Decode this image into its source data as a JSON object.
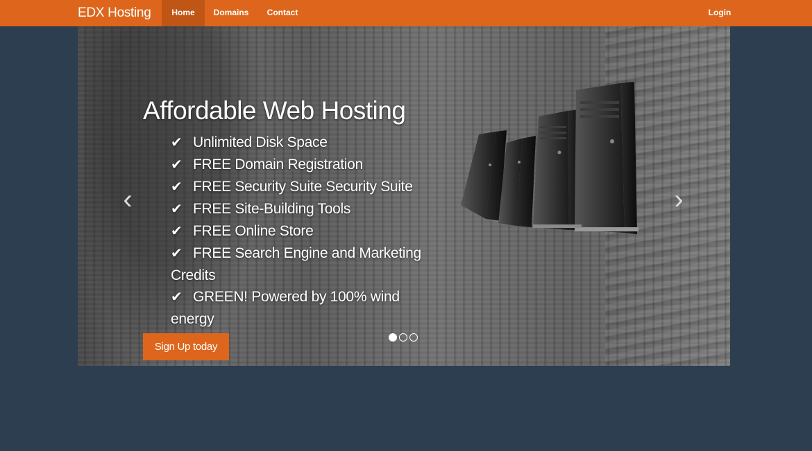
{
  "nav": {
    "brand": "EDX Hosting",
    "home": "Home",
    "domains": "Domains",
    "contact": "Contact",
    "login": "Login"
  },
  "hero": {
    "title": "Affordable Web Hosting",
    "features": [
      "Unlimited Disk Space",
      "FREE Domain Registration",
      "FREE Security Suite Security Suite",
      "FREE Site-Building Tools",
      "FREE Online Store",
      "FREE Search Engine and Marketing Credits",
      "GREEN! Powered by 100% wind energy"
    ],
    "signup": "Sign Up today",
    "check_glyph": "✔",
    "prev_glyph": "‹",
    "next_glyph": "›"
  },
  "carousel": {
    "slide_count": 3,
    "active_slide": 1
  },
  "colors": {
    "accent": "#dd661c",
    "background": "#2c3e50"
  }
}
